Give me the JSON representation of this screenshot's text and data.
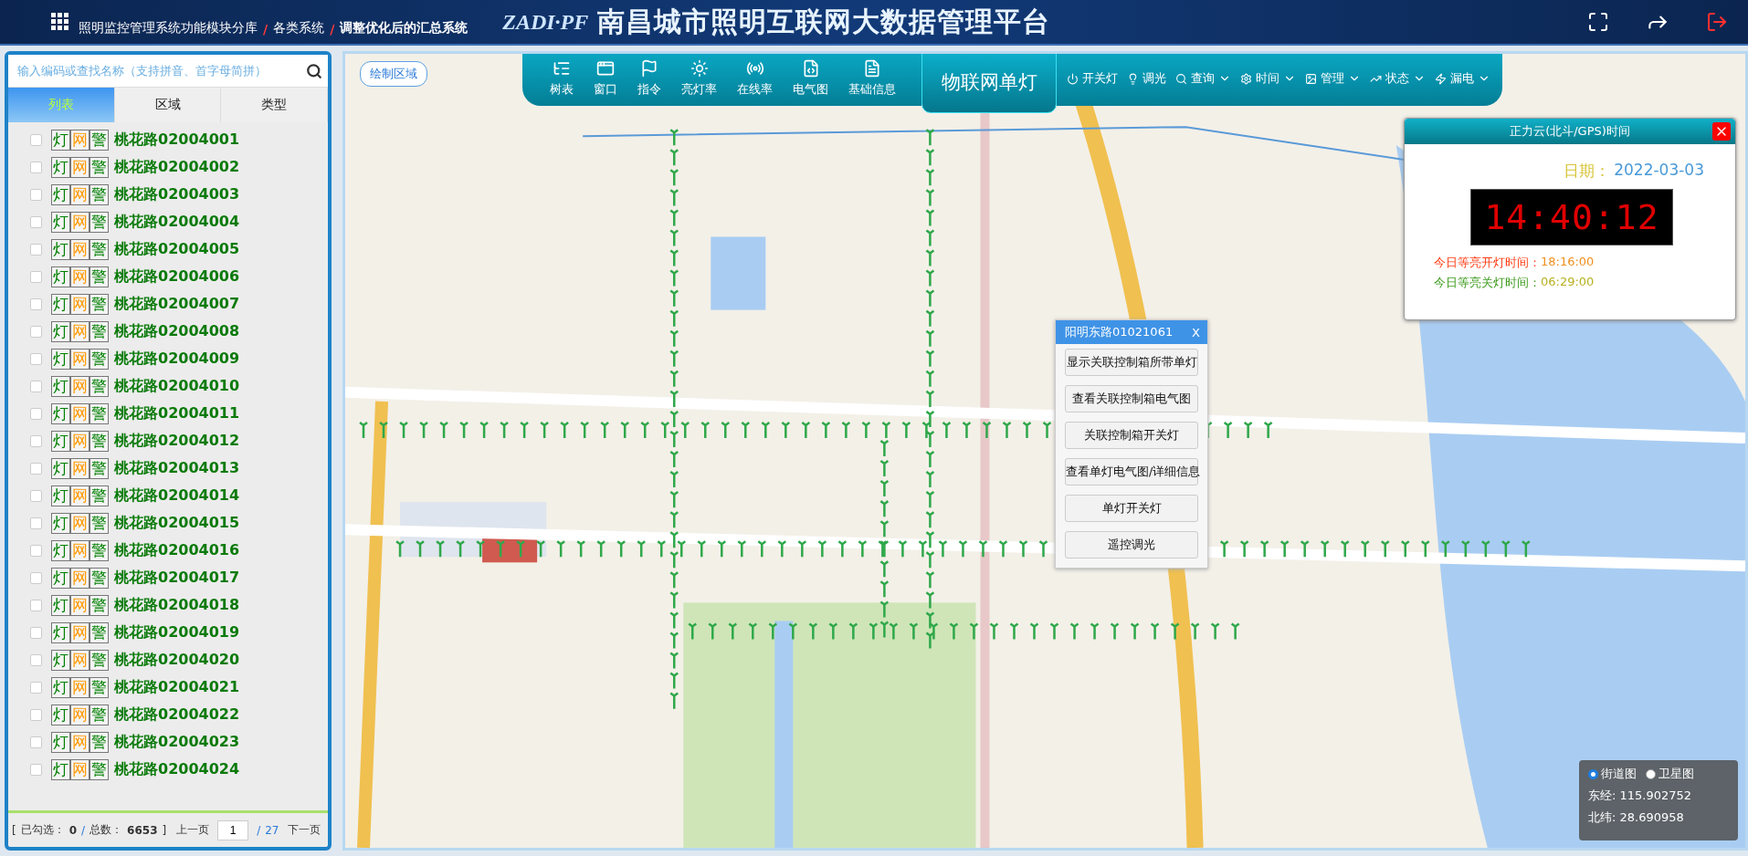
{
  "header": {
    "breadcrumbs": [
      {
        "label": "照明监控管理系统功能模块分库",
        "current": false
      },
      {
        "label": "各类系统",
        "current": false
      },
      {
        "label": "调整优化后的汇总系统",
        "current": true
      }
    ],
    "separator": "/",
    "logo_text": "ZADI·PF",
    "title": "南昌城市照明互联网大数据管理平台"
  },
  "sidebar": {
    "search": {
      "placeholder": "输入编码或查找名称（支持拼音、首字母简拼）"
    },
    "tabs": [
      {
        "label": "列表",
        "selected": true
      },
      {
        "label": "区域",
        "selected": false
      },
      {
        "label": "类型",
        "selected": false
      }
    ],
    "items": [
      {
        "name": "桃花路02004001",
        "checked": false,
        "badges": [
          {
            "label": "灯",
            "color": "#008000"
          },
          {
            "label": "网",
            "color": "#ff9900"
          },
          {
            "label": "警",
            "color": "#008000"
          }
        ]
      },
      {
        "name": "桃花路02004002",
        "checked": false,
        "badges": [
          {
            "label": "灯",
            "color": "#008000"
          },
          {
            "label": "网",
            "color": "#ff9900"
          },
          {
            "label": "警",
            "color": "#008000"
          }
        ]
      },
      {
        "name": "桃花路02004003",
        "checked": false,
        "badges": [
          {
            "label": "灯",
            "color": "#008000"
          },
          {
            "label": "网",
            "color": "#ff9900"
          },
          {
            "label": "警",
            "color": "#008000"
          }
        ]
      },
      {
        "name": "桃花路02004004",
        "checked": false,
        "badges": [
          {
            "label": "灯",
            "color": "#008000"
          },
          {
            "label": "网",
            "color": "#ff9900"
          },
          {
            "label": "警",
            "color": "#008000"
          }
        ]
      },
      {
        "name": "桃花路02004005",
        "checked": false,
        "badges": [
          {
            "label": "灯",
            "color": "#008000"
          },
          {
            "label": "网",
            "color": "#ff9900"
          },
          {
            "label": "警",
            "color": "#008000"
          }
        ]
      },
      {
        "name": "桃花路02004006",
        "checked": false,
        "badges": [
          {
            "label": "灯",
            "color": "#008000"
          },
          {
            "label": "网",
            "color": "#ff9900"
          },
          {
            "label": "警",
            "color": "#008000"
          }
        ]
      },
      {
        "name": "桃花路02004007",
        "checked": false,
        "badges": [
          {
            "label": "灯",
            "color": "#008000"
          },
          {
            "label": "网",
            "color": "#ff9900"
          },
          {
            "label": "警",
            "color": "#008000"
          }
        ]
      },
      {
        "name": "桃花路02004008",
        "checked": false,
        "badges": [
          {
            "label": "灯",
            "color": "#008000"
          },
          {
            "label": "网",
            "color": "#ff9900"
          },
          {
            "label": "警",
            "color": "#008000"
          }
        ]
      },
      {
        "name": "桃花路02004009",
        "checked": false,
        "badges": [
          {
            "label": "灯",
            "color": "#008000"
          },
          {
            "label": "网",
            "color": "#ff9900"
          },
          {
            "label": "警",
            "color": "#008000"
          }
        ]
      },
      {
        "name": "桃花路02004010",
        "checked": false,
        "badges": [
          {
            "label": "灯",
            "color": "#008000"
          },
          {
            "label": "网",
            "color": "#ff9900"
          },
          {
            "label": "警",
            "color": "#008000"
          }
        ]
      },
      {
        "name": "桃花路02004011",
        "checked": false,
        "badges": [
          {
            "label": "灯",
            "color": "#008000"
          },
          {
            "label": "网",
            "color": "#ff9900"
          },
          {
            "label": "警",
            "color": "#008000"
          }
        ]
      },
      {
        "name": "桃花路02004012",
        "checked": false,
        "badges": [
          {
            "label": "灯",
            "color": "#008000"
          },
          {
            "label": "网",
            "color": "#ff9900"
          },
          {
            "label": "警",
            "color": "#008000"
          }
        ]
      },
      {
        "name": "桃花路02004013",
        "checked": false,
        "badges": [
          {
            "label": "灯",
            "color": "#008000"
          },
          {
            "label": "网",
            "color": "#ff9900"
          },
          {
            "label": "警",
            "color": "#008000"
          }
        ]
      },
      {
        "name": "桃花路02004014",
        "checked": false,
        "badges": [
          {
            "label": "灯",
            "color": "#008000"
          },
          {
            "label": "网",
            "color": "#ff9900"
          },
          {
            "label": "警",
            "color": "#008000"
          }
        ]
      },
      {
        "name": "桃花路02004015",
        "checked": false,
        "badges": [
          {
            "label": "灯",
            "color": "#008000"
          },
          {
            "label": "网",
            "color": "#ff9900"
          },
          {
            "label": "警",
            "color": "#008000"
          }
        ]
      },
      {
        "name": "桃花路02004016",
        "checked": false,
        "badges": [
          {
            "label": "灯",
            "color": "#008000"
          },
          {
            "label": "网",
            "color": "#ff9900"
          },
          {
            "label": "警",
            "color": "#008000"
          }
        ]
      },
      {
        "name": "桃花路02004017",
        "checked": false,
        "badges": [
          {
            "label": "灯",
            "color": "#008000"
          },
          {
            "label": "网",
            "color": "#ff9900"
          },
          {
            "label": "警",
            "color": "#008000"
          }
        ]
      },
      {
        "name": "桃花路02004018",
        "checked": false,
        "badges": [
          {
            "label": "灯",
            "color": "#008000"
          },
          {
            "label": "网",
            "color": "#ff9900"
          },
          {
            "label": "警",
            "color": "#008000"
          }
        ]
      },
      {
        "name": "桃花路02004019",
        "checked": false,
        "badges": [
          {
            "label": "灯",
            "color": "#008000"
          },
          {
            "label": "网",
            "color": "#ff9900"
          },
          {
            "label": "警",
            "color": "#008000"
          }
        ]
      },
      {
        "name": "桃花路02004020",
        "checked": false,
        "badges": [
          {
            "label": "灯",
            "color": "#008000"
          },
          {
            "label": "网",
            "color": "#ff9900"
          },
          {
            "label": "警",
            "color": "#008000"
          }
        ]
      },
      {
        "name": "桃花路02004021",
        "checked": false,
        "badges": [
          {
            "label": "灯",
            "color": "#008000"
          },
          {
            "label": "网",
            "color": "#ff9900"
          },
          {
            "label": "警",
            "color": "#008000"
          }
        ]
      },
      {
        "name": "桃花路02004022",
        "checked": false,
        "badges": [
          {
            "label": "灯",
            "color": "#008000"
          },
          {
            "label": "网",
            "color": "#ff9900"
          },
          {
            "label": "警",
            "color": "#008000"
          }
        ]
      },
      {
        "name": "桃花路02004023",
        "checked": false,
        "badges": [
          {
            "label": "灯",
            "color": "#008000"
          },
          {
            "label": "网",
            "color": "#ff9900"
          },
          {
            "label": "警",
            "color": "#008000"
          }
        ]
      },
      {
        "name": "桃花路02004024",
        "checked": false,
        "badges": [
          {
            "label": "灯",
            "color": "#008000"
          },
          {
            "label": "网",
            "color": "#ff9900"
          },
          {
            "label": "警",
            "color": "#008000"
          }
        ]
      }
    ],
    "footer": {
      "open": "[",
      "selected_label": "已勾选：",
      "selected_count": "0",
      "slash": "/",
      "total_label": "总数：",
      "total": "6653",
      "close": "]",
      "prev": "上一页",
      "page": "1",
      "page_slash": "/",
      "pages": "27",
      "next": "下一页"
    }
  },
  "map": {
    "draw_area_button": "绘制区域",
    "toolbar": {
      "buttons": [
        {
          "label": "树表"
        },
        {
          "label": "窗口"
        },
        {
          "label": "指令"
        },
        {
          "label": "亮灯率"
        },
        {
          "label": "在线率"
        },
        {
          "label": "电气图"
        },
        {
          "label": "基础信息"
        }
      ],
      "title": "物联网单灯",
      "menus": [
        {
          "label": "开关灯",
          "dropdown": false
        },
        {
          "label": "调光",
          "dropdown": false
        },
        {
          "label": "查询",
          "dropdown": true
        },
        {
          "label": "时间",
          "dropdown": true
        },
        {
          "label": "管理",
          "dropdown": true
        },
        {
          "label": "状态",
          "dropdown": true
        },
        {
          "label": "漏电",
          "dropdown": true
        }
      ]
    },
    "time_panel": {
      "title": "正力云(北斗/GPS)时间",
      "date_label": "日期：",
      "date": "2022-03-03",
      "clock": "14:40:12",
      "on_label": "今日等亮开灯时间：",
      "on_time": "18:16:00",
      "off_label": "今日等亮关灯时间：",
      "off_time": "06:29:00"
    },
    "popup": {
      "title": "阳明东路01021061",
      "close": "X",
      "actions": [
        "显示关联控制箱所带单灯",
        "查看关联控制箱电气图",
        "关联控制箱开关灯",
        "查看单灯电气图/详细信息",
        "单灯开关灯",
        "遥控调光"
      ]
    },
    "map_type": {
      "options": [
        {
          "label": "街道图",
          "selected": true
        },
        {
          "label": "卫星图",
          "selected": false
        }
      ],
      "lon_label": "东经:",
      "lon": "115.902752",
      "lat_label": "北纬:",
      "lat": "28.690958"
    }
  }
}
